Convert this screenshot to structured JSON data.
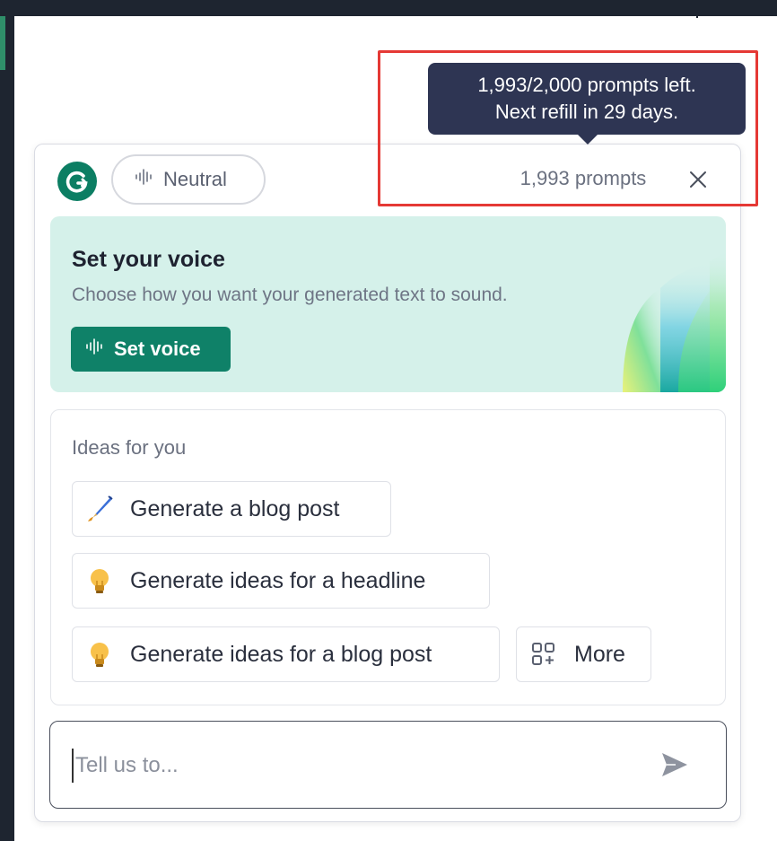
{
  "tooltip": {
    "line1": "1,993/2,000 prompts left.",
    "line2": "Next refill in 29 days."
  },
  "header": {
    "logo_letter": "G",
    "tone_label": "Neutral",
    "prompts_count": "1,993 prompts",
    "close_icon": "close-icon"
  },
  "voice_card": {
    "title": "Set your voice",
    "subtitle": "Choose how you want your generated text to sound.",
    "button_label": "Set voice",
    "button_icon": "waveform-icon"
  },
  "ideas": {
    "title": "Ideas for you",
    "items": [
      {
        "label": "Generate a blog post",
        "icon": "pen-icon"
      },
      {
        "label": "Generate ideas for a headline",
        "icon": "lightbulb-icon"
      },
      {
        "label": "Generate ideas for a blog post",
        "icon": "lightbulb-icon"
      }
    ],
    "more_label": "More",
    "more_icon": "grid-plus-icon"
  },
  "input": {
    "placeholder": "Tell us to...",
    "value": "",
    "send_icon": "send-icon"
  },
  "colors": {
    "brand_green": "#0f8168",
    "tooltip_bg": "#2e3553",
    "highlight_red": "#e53935",
    "voice_card_bg": "#d5f1ea"
  }
}
